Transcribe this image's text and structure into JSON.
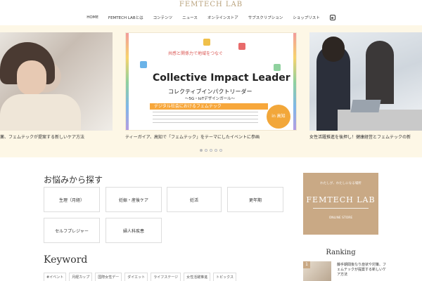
{
  "header": {
    "logo": "FEMTECH LAB",
    "nav": [
      "HOME",
      "FEMTECH LABとは",
      "コンテンツ",
      "ニュース",
      "オンラインストア",
      "サブスクリプション",
      "ショップリスト"
    ]
  },
  "slider": {
    "captions": [
      "薬、フェムテックが提案する新しいケア方法",
      "ティーガイア、高知で「フェムテック」をテーマにしたイベントに参画",
      "女性活躍推進を後押し！健康経営とフェムテックの新"
    ],
    "center_slide": {
      "subtitle": "共感と関係力で地域をつなぐ",
      "title": "Collective Impact Leader",
      "title_jp": "コレクティブインパクトリーダー",
      "tagline": "〜5G・IoTデザインガール〜",
      "banner": "デジタル社会におけるフェムテック",
      "badge": "in 高知"
    },
    "dot_count": 5,
    "active_dot": 0
  },
  "concerns": {
    "title": "お悩みから探す",
    "items": [
      "生理（月経）",
      "妊娠・産後ケア",
      "妊活",
      "更年期",
      "セルフプレジャー",
      "婦人科疾患"
    ]
  },
  "keyword": {
    "title": "Keyword",
    "tags": [
      "#イベント",
      "月経カップ",
      "国際女性デー",
      "ダイエット",
      "ライフステージ",
      "女性活躍推進",
      "トピックス"
    ]
  },
  "sidebar": {
    "banner_tagline": "わたしが、わたしになる場所",
    "banner_name": "FEMTECH LAB",
    "banner_store": "ONLINE STORE",
    "ranking_title": "Ranking",
    "ranking_items": [
      {
        "rank": "1",
        "text": "藤手期間後なり症状や対策、フェムテックが提案する新しいケア方法"
      }
    ]
  }
}
